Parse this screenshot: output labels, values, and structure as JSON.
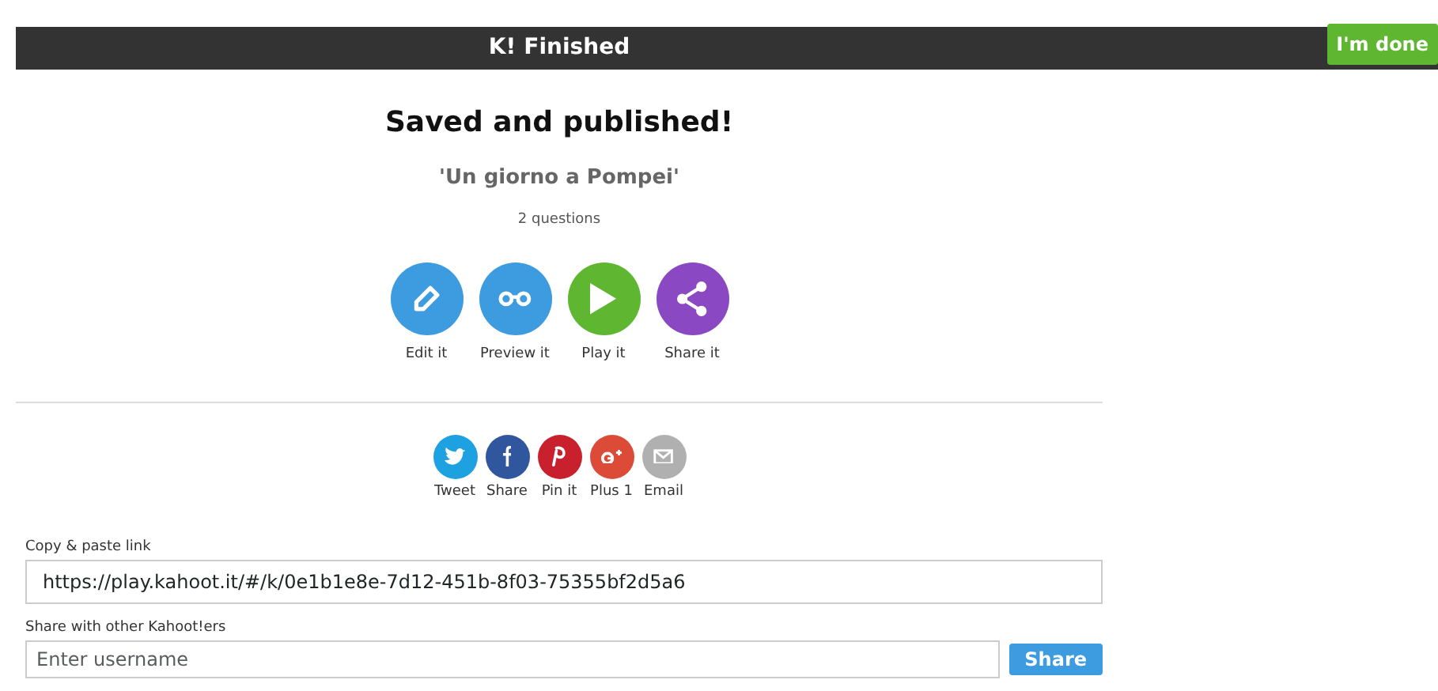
{
  "top_bar": {
    "logo": "K!",
    "title": "Finished",
    "done_button": "I'm done"
  },
  "heading": "Saved and published!",
  "quiz_title": "'Un giorno a Pompei'",
  "question_count": "2 questions",
  "actions": [
    {
      "kind": "edit",
      "label": "Edit it",
      "color": "#3d9be0"
    },
    {
      "kind": "preview",
      "label": "Preview it",
      "color": "#3d9be0"
    },
    {
      "kind": "play",
      "label": "Play it",
      "color": "#5fb630"
    },
    {
      "kind": "share",
      "label": "Share it",
      "color": "#8a48c2"
    }
  ],
  "social": [
    {
      "kind": "twitter",
      "label": "Tweet",
      "color": "#1da1e0"
    },
    {
      "kind": "facebook",
      "label": "Share",
      "color": "#30579e"
    },
    {
      "kind": "pinterest",
      "label": "Pin it",
      "color": "#c8202c"
    },
    {
      "kind": "googleplus",
      "label": "Plus 1",
      "color": "#dc4a38"
    },
    {
      "kind": "email",
      "label": "Email",
      "color": "#b0b0b0"
    }
  ],
  "link_field": {
    "label": "Copy & paste link",
    "value": "https://play.kahoot.it/#/k/0e1b1e8e-7d12-451b-8f03-75355bf2d5a6"
  },
  "share_field": {
    "label": "Share with other Kahoot!ers",
    "placeholder": "Enter username",
    "button": "Share"
  }
}
